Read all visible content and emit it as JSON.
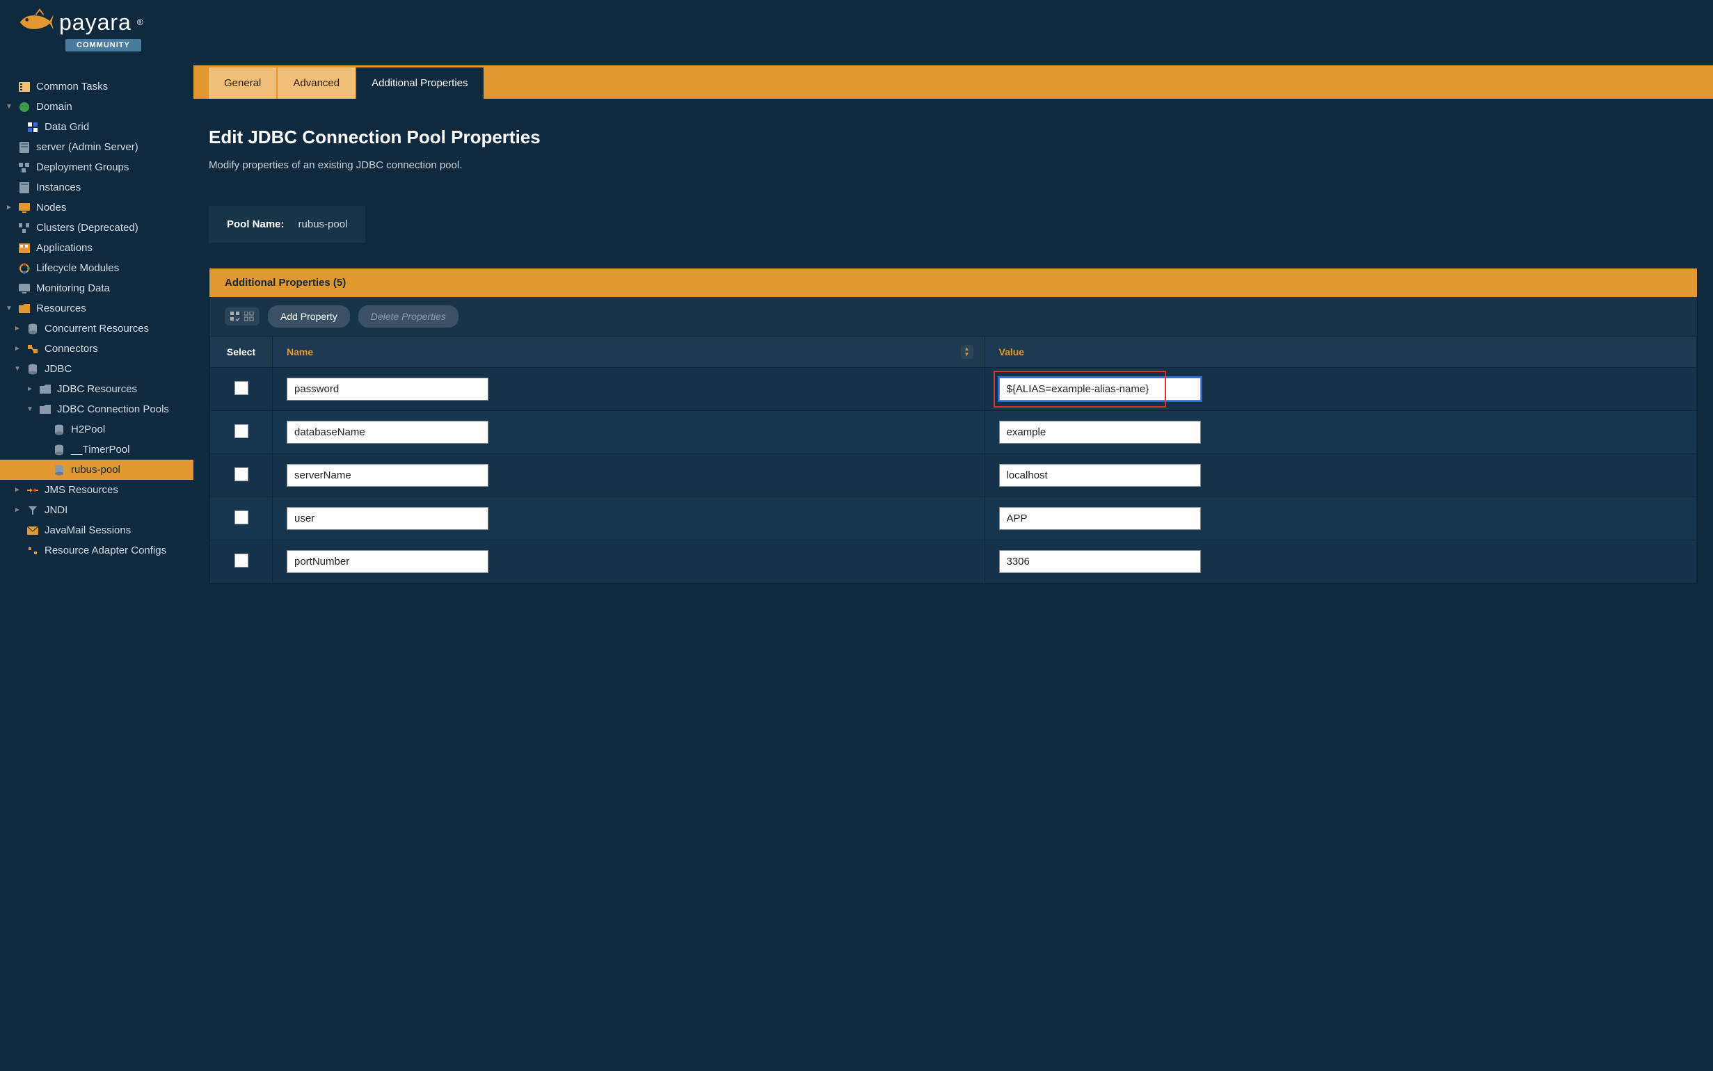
{
  "brand": {
    "name": "payara",
    "badge": "COMMUNITY"
  },
  "sidebar": {
    "items": [
      {
        "label": "Common Tasks"
      },
      {
        "label": "Domain"
      },
      {
        "label": "Data Grid"
      },
      {
        "label": "server (Admin Server)"
      },
      {
        "label": "Deployment Groups"
      },
      {
        "label": "Instances"
      },
      {
        "label": "Nodes"
      },
      {
        "label": "Clusters (Deprecated)"
      },
      {
        "label": "Applications"
      },
      {
        "label": "Lifecycle Modules"
      },
      {
        "label": "Monitoring Data"
      },
      {
        "label": "Resources"
      },
      {
        "label": "Concurrent Resources"
      },
      {
        "label": "Connectors"
      },
      {
        "label": "JDBC"
      },
      {
        "label": "JDBC Resources"
      },
      {
        "label": "JDBC Connection Pools"
      },
      {
        "label": "H2Pool"
      },
      {
        "label": "__TimerPool"
      },
      {
        "label": "rubus-pool"
      },
      {
        "label": "JMS Resources"
      },
      {
        "label": "JNDI"
      },
      {
        "label": "JavaMail Sessions"
      },
      {
        "label": "Resource Adapter Configs"
      }
    ]
  },
  "tabs": [
    {
      "label": "General"
    },
    {
      "label": "Advanced"
    },
    {
      "label": "Additional Properties"
    }
  ],
  "page": {
    "title": "Edit JDBC Connection Pool Properties",
    "description": "Modify properties of an existing JDBC connection pool.",
    "pool_name_label": "Pool Name:",
    "pool_name_value": "rubus-pool"
  },
  "table": {
    "title": "Additional Properties (5)",
    "toolbar": {
      "add_label": "Add Property",
      "delete_label": "Delete Properties"
    },
    "columns": {
      "select": "Select",
      "name": "Name",
      "value": "Value"
    },
    "rows": [
      {
        "name": "password",
        "value": "${ALIAS=example-alias-name}"
      },
      {
        "name": "databaseName",
        "value": "example"
      },
      {
        "name": "serverName",
        "value": "localhost"
      },
      {
        "name": "user",
        "value": "APP"
      },
      {
        "name": "portNumber",
        "value": "3306"
      }
    ]
  }
}
